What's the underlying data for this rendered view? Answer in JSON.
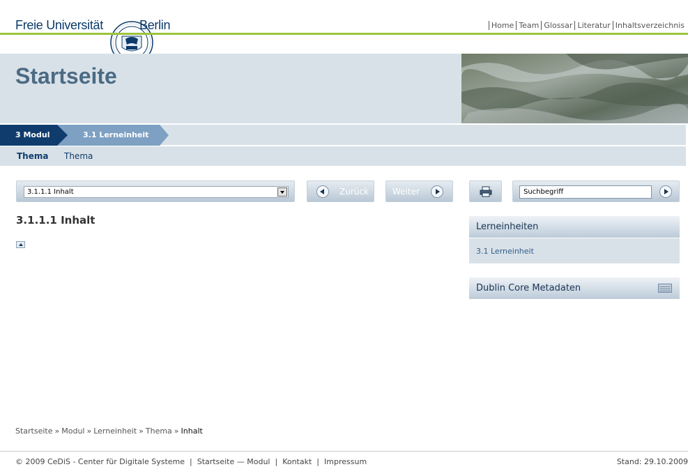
{
  "header": {
    "logo_left": "Freie Universität",
    "logo_right": "Berlin",
    "nav": [
      "Home",
      "Team",
      "Glossar",
      "Literatur",
      "Inhaltsverzeichnis"
    ]
  },
  "banner": {
    "title": "Startseite"
  },
  "crumbs": {
    "modul": "3 Modul",
    "lerneinheit": "3.1 Lerneinheit"
  },
  "subnav": {
    "active": "Thema",
    "link": "Thema"
  },
  "toolbar": {
    "select_value": "3.1.1.1 Inhalt",
    "back_label": "Zurück",
    "next_label": "Weiter",
    "search_value": "Suchbegriff"
  },
  "main": {
    "heading": "3.1.1.1 Inhalt"
  },
  "sidebar": {
    "lerneinheiten_title": "Lerneinheiten",
    "lerneinheiten_item": "3.1 Lerneinheit",
    "dublin_title": "Dublin Core Metadaten"
  },
  "breadcrumb": {
    "items": [
      "Startseite",
      "Modul",
      "Lerneinheit",
      "Thema"
    ],
    "current": "Inhalt",
    "separator": "»"
  },
  "footer": {
    "copyright": "© 2009  CeDiS - Center für Digitale Systeme",
    "links": [
      "Startseite — Modul",
      "Kontakt",
      "Impressum"
    ],
    "stand": "Stand: 29.10.2009"
  },
  "colors": {
    "dark_blue": "#0f3c6d",
    "light_blue": "#7da0c3",
    "panel": "#d9e1e8",
    "green": "#9bc53d"
  }
}
